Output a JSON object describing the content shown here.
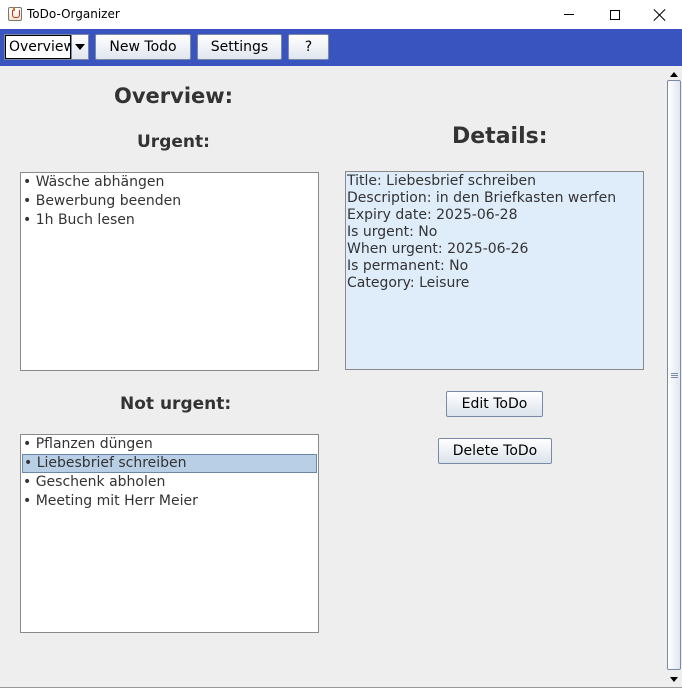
{
  "window": {
    "title": "ToDo-Organizer",
    "icon": "java-cup-icon"
  },
  "toolbar": {
    "view_select": {
      "selected": "Overview"
    },
    "new_todo_label": "New Todo",
    "settings_label": "Settings",
    "help_label": "?",
    "background_color": "#3a54bf"
  },
  "main": {
    "overview_heading": "Overview:",
    "urgent_heading": "Urgent:",
    "not_urgent_heading": "Not urgent:",
    "details_heading": "Details:",
    "urgent_items": [
      "• Wäsche abhängen",
      "• Bewerbung beenden",
      "• 1h Buch lesen"
    ],
    "not_urgent_items": [
      "• Pflanzen düngen",
      "• Liebesbrief schreiben",
      "• Geschenk abholen",
      "• Meeting mit Herr Meier"
    ],
    "selected_item": "• Liebesbrief schreiben",
    "details": [
      "Title: Liebesbrief schreiben",
      "Description: in den Briefkasten werfen",
      "Expiry date: 2025-06-28",
      "Is urgent: No",
      "When urgent: 2025-06-26",
      "Is permanent: No",
      "Category: Leisure"
    ],
    "edit_button_label": "Edit ToDo",
    "delete_button_label": "Delete ToDo",
    "details_background": "#dfecf9",
    "selection_color": "#b8cfe5"
  }
}
